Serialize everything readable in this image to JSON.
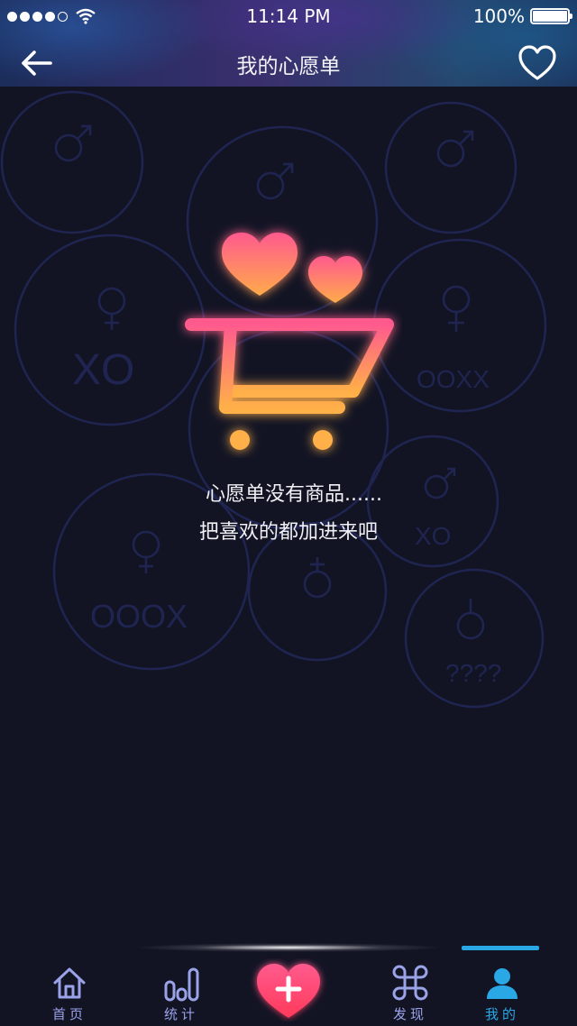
{
  "status_bar": {
    "time": "11:14 PM",
    "battery": "100%"
  },
  "header": {
    "title": "我的心愿单",
    "back_icon": "arrow-left-icon",
    "favorite_icon": "heart-outline-icon"
  },
  "empty_state": {
    "line1": "心愿单没有商品......",
    "line2": "把喜欢的都加进来吧",
    "illustration": "cart-with-hearts-icon"
  },
  "background_badges": [
    "XO",
    "OOXX",
    "OOOX",
    "XO",
    "????"
  ],
  "tabbar": {
    "items": [
      {
        "label": "首页",
        "icon": "home-icon"
      },
      {
        "label": "统计",
        "icon": "bar-chart-icon"
      },
      {
        "label": "",
        "icon": "heart-plus-icon"
      },
      {
        "label": "发现",
        "icon": "command-icon"
      },
      {
        "label": "我的",
        "icon": "user-icon"
      }
    ],
    "active_index": 4
  },
  "colors": {
    "background": "#121424",
    "accent_active": "#2aa8e6",
    "tab_inactive": "#9aa2e8",
    "illustration_pink": "#ff5a8e",
    "illustration_orange": "#ffab4a"
  }
}
